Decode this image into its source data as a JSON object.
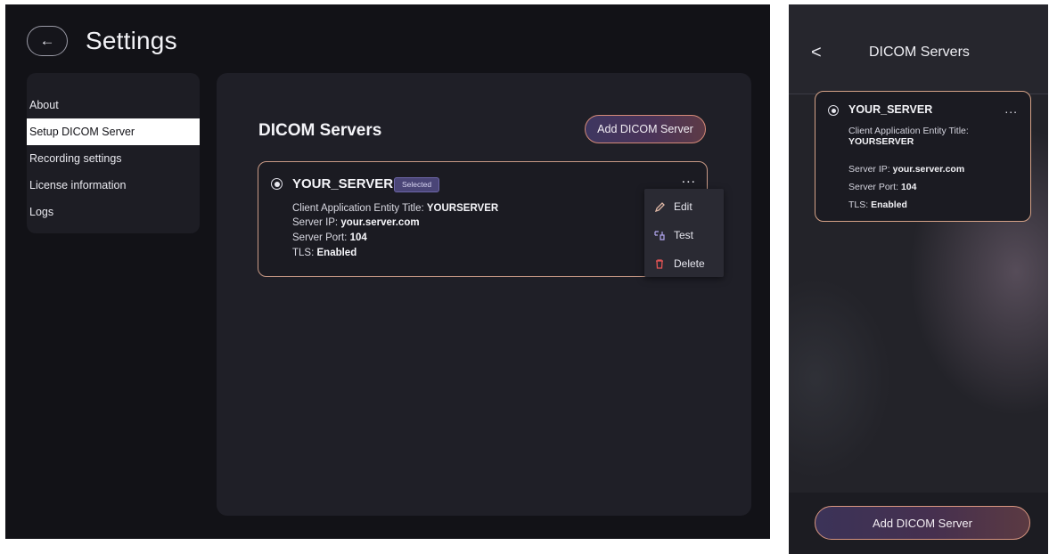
{
  "desktop": {
    "back_icon": "←",
    "title": "Settings",
    "sidebar": {
      "items": [
        {
          "label": "About"
        },
        {
          "label": "Setup DICOM Server",
          "active": true
        },
        {
          "label": "Recording settings"
        },
        {
          "label": "License information"
        },
        {
          "label": "Logs"
        }
      ]
    },
    "panel": {
      "title": "DICOM Servers",
      "add_button": "Add DICOM Server",
      "server": {
        "name": "YOUR_SERVER",
        "badge": "Selected",
        "more": "...",
        "client_label": "Client Application Entity Title:",
        "client_value": "YOURSERVER",
        "ip_label": "Server IP:",
        "ip_value": "your.server.com",
        "port_label": "Server Port:",
        "port_value": "104",
        "tls_label": "TLS:",
        "tls_value": "Enabled"
      }
    },
    "context_menu": {
      "edit": "Edit",
      "test": "Test",
      "delete": "Delete"
    }
  },
  "mobile": {
    "back_icon": "<",
    "title": "DICOM Servers",
    "server": {
      "name": "YOUR_SERVER",
      "more": "...",
      "client_label": "Client Application Entity Title:",
      "client_value": "YOURSERVER",
      "ip_label": "Server IP:",
      "ip_value": "your.server.com",
      "port_label": "Server Port:",
      "port_value": "104",
      "tls_label": "TLS:",
      "tls_value": "Enabled"
    },
    "add_button": "Add DICOM Server"
  },
  "icons": {
    "edit": "pencil-icon",
    "test": "test-connection-icon",
    "delete": "trash-icon"
  },
  "colors": {
    "accent_border": "#d48a78",
    "badge_bg": "#4a4577",
    "delete_icon": "#e45454"
  }
}
